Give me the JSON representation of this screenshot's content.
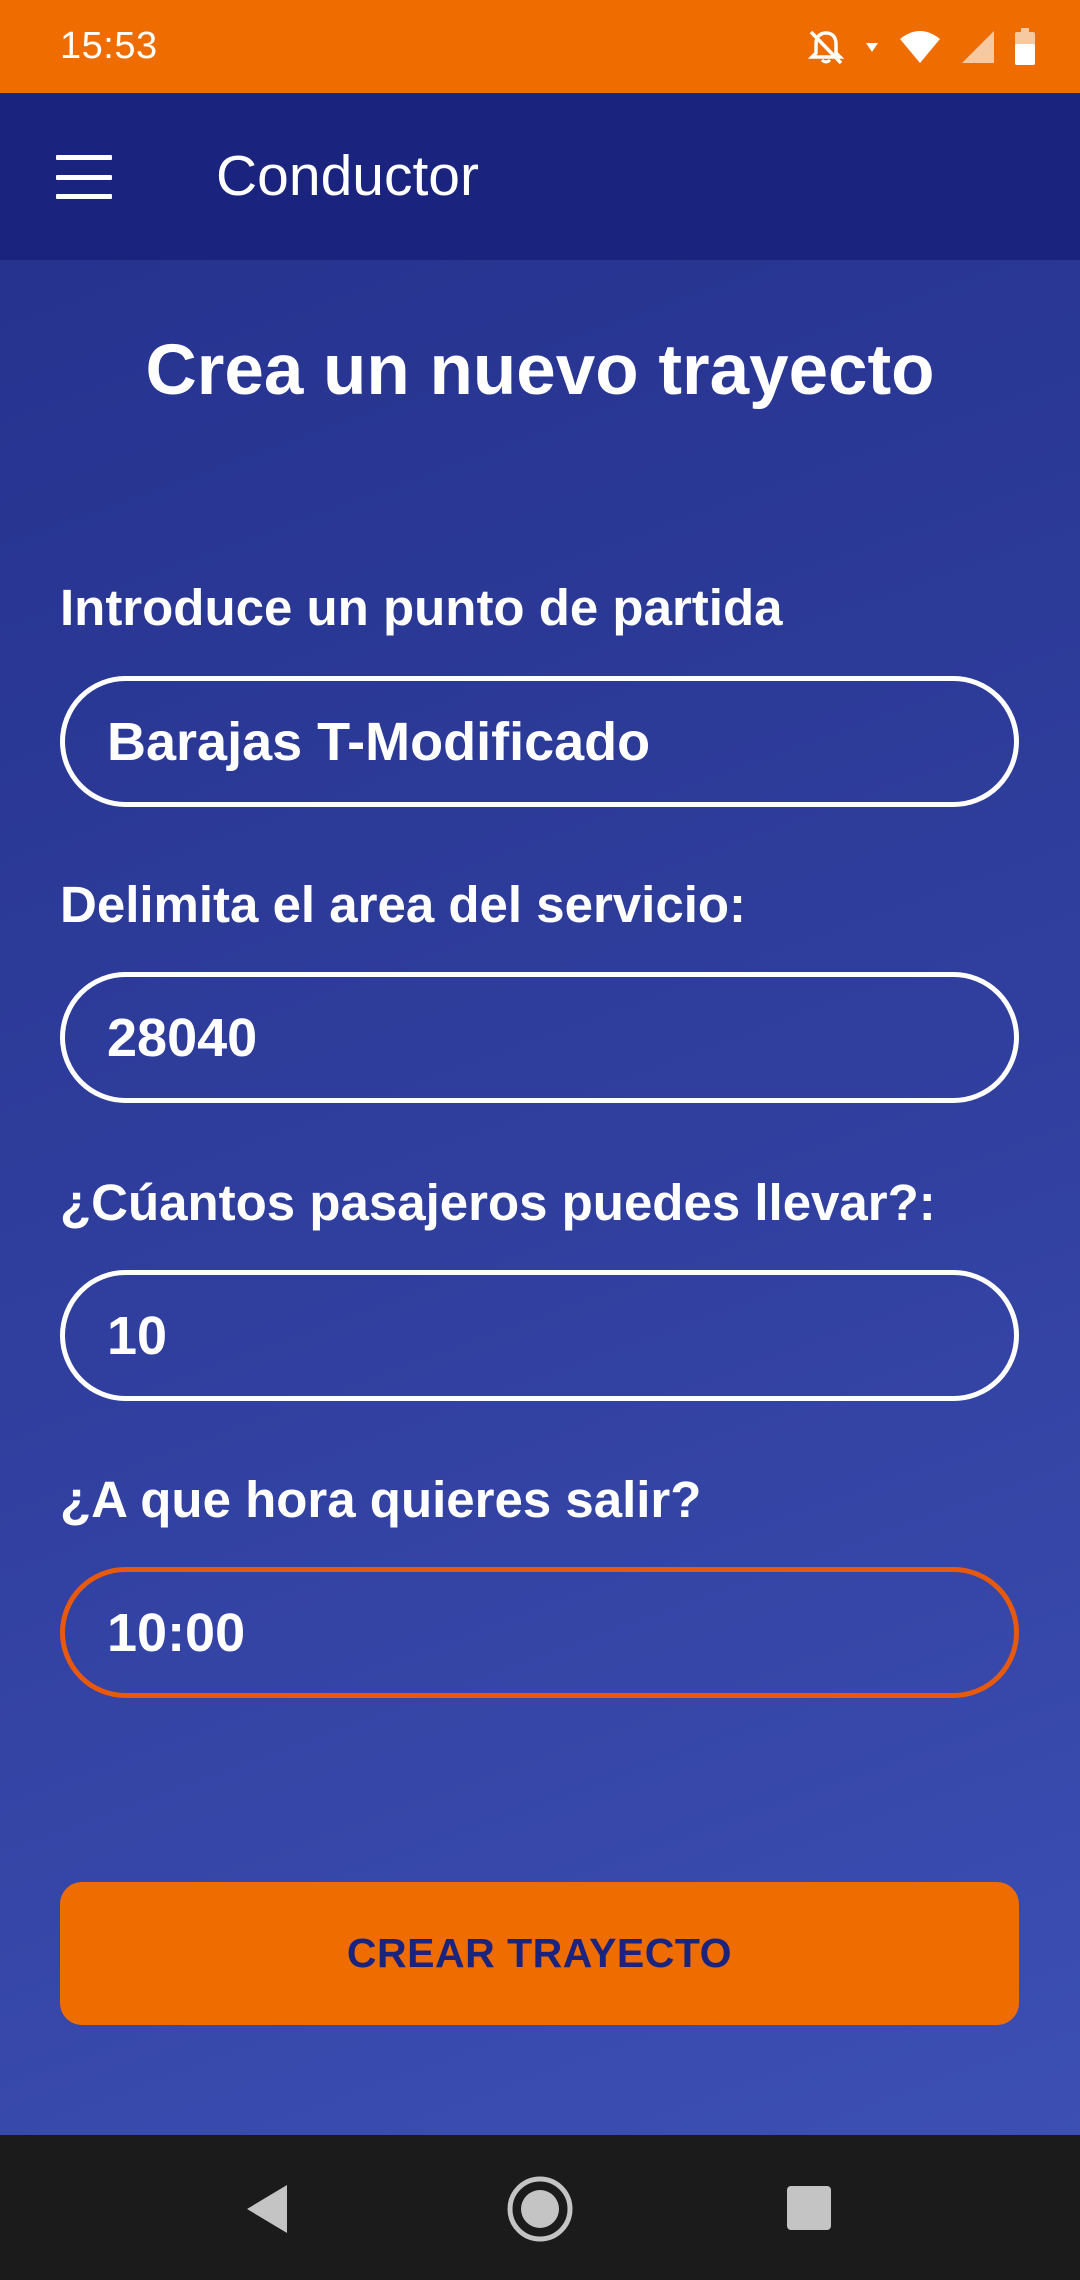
{
  "status_bar": {
    "time": "15:53",
    "icons": [
      "bell-off-icon",
      "data-arrow-icon",
      "wifi-icon",
      "signal-icon",
      "battery-icon"
    ]
  },
  "app_bar": {
    "title": "Conductor",
    "menu_icon": "hamburger-menu-icon"
  },
  "page": {
    "title": "Crea un nuevo trayecto"
  },
  "form": {
    "start": {
      "label": "Introduce un punto de partida",
      "value": "Barajas T-Modificado"
    },
    "area": {
      "label": "Delimita el area del servicio:",
      "value": "28040"
    },
    "passengers": {
      "label": "¿Cúantos pasajeros puedes llevar?:",
      "value": "10"
    },
    "time": {
      "label": "¿A que hora quieres salir?",
      "value": "10:00"
    }
  },
  "actions": {
    "create_label": "CREAR TRAYECTO"
  },
  "nav_bar": {
    "icons": [
      "back-icon",
      "home-icon",
      "recents-icon"
    ]
  },
  "colors": {
    "status_bar": "#ef6c00",
    "app_bar": "#1a237e",
    "accent": "#ef6c00",
    "focus_border": "#e8590c",
    "nav_bar": "#1b1b1b"
  }
}
